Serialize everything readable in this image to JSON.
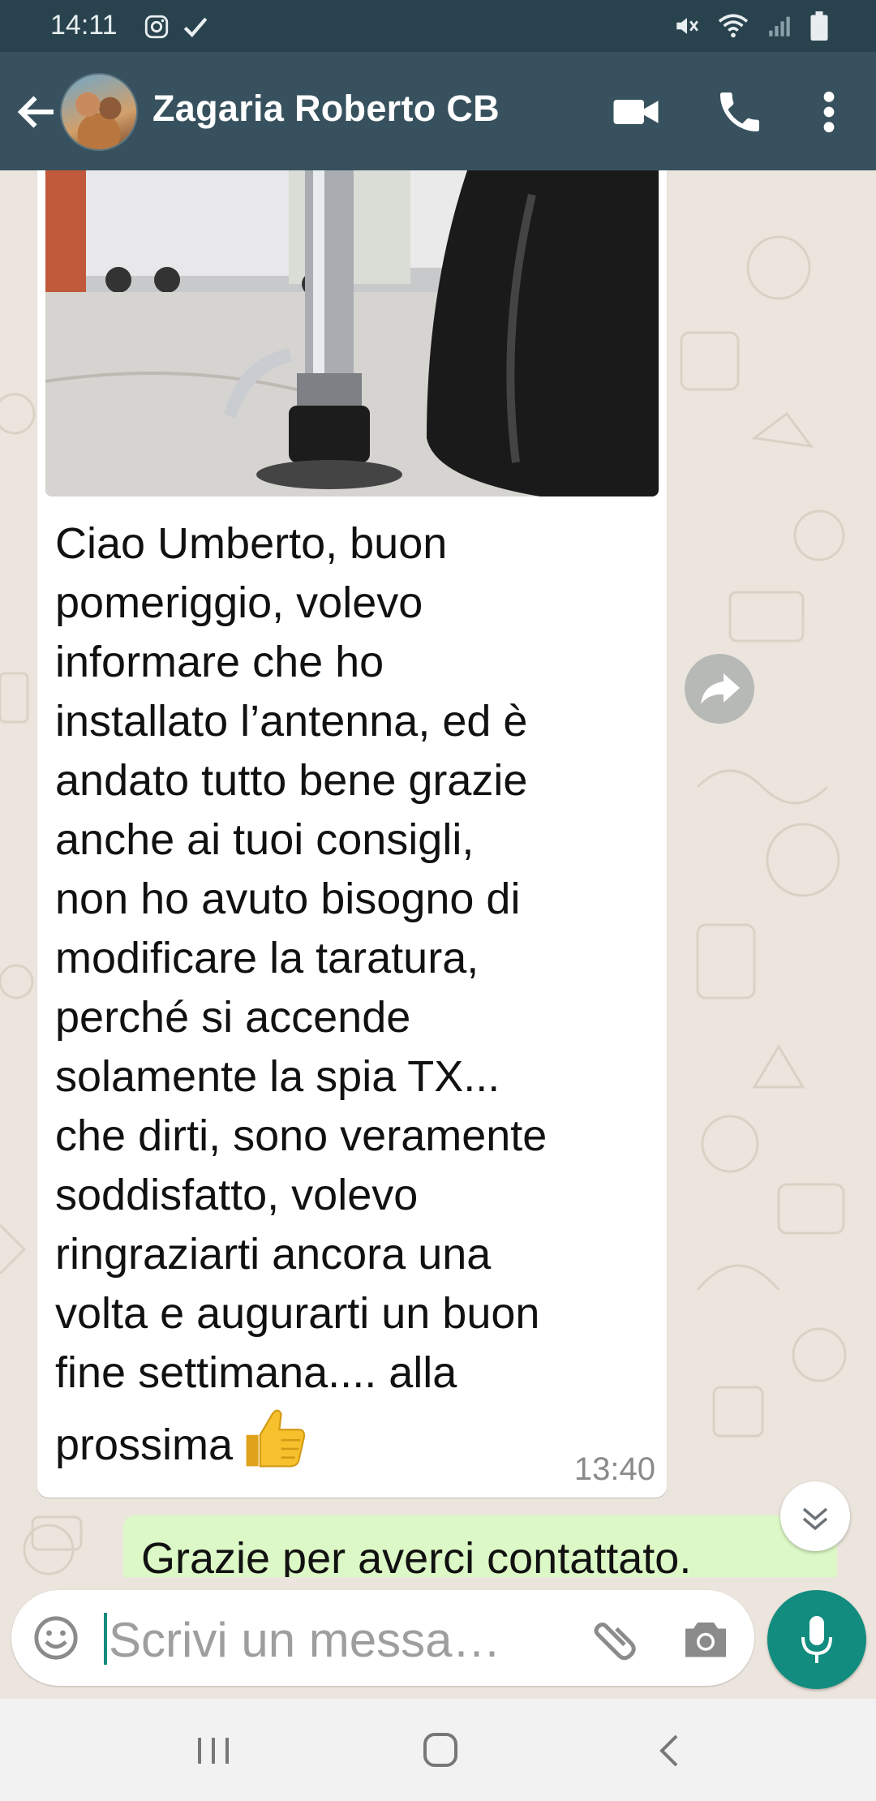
{
  "status_bar": {
    "time": "14:11",
    "left_icons": [
      "instagram-icon",
      "check-icon"
    ],
    "right_icons": [
      "mute-icon",
      "wifi-icon",
      "signal-icon",
      "battery-icon"
    ]
  },
  "header": {
    "contact_name": "Zagaria Roberto CB",
    "icons": [
      "back-arrow-icon",
      "avatar",
      "video-call-icon",
      "phone-icon",
      "more-vert-icon"
    ]
  },
  "chat": {
    "incoming_message": {
      "text": "Ciao Umberto, buon\npomeriggio, volevo\ninformare che ho\ninstallato l’antenna, ed è\nandato tutto bene grazie\nanche ai tuoi consigli,\nnon ho avuto bisogno di\nmodificare la taratura,\nperché si accende\nsolamente la spia TX...\nche dirti, sono veramente\nsoddisfatto, volevo\nringraziarti ancora una\nvolta e augurarti un buon\nfine settimana.... alla\nprossima",
      "emoji": "thumbs-up",
      "time": "13:40"
    },
    "outgoing_message": {
      "text": "Grazie per averci contattato."
    }
  },
  "composer": {
    "placeholder": "Scrivi un messa…"
  },
  "colors": {
    "header": "#37525e",
    "status_bar": "#29434e",
    "chat_bg": "#ece5dd",
    "outgoing_bubble": "#dcf8c6",
    "accent": "#128c7e"
  }
}
